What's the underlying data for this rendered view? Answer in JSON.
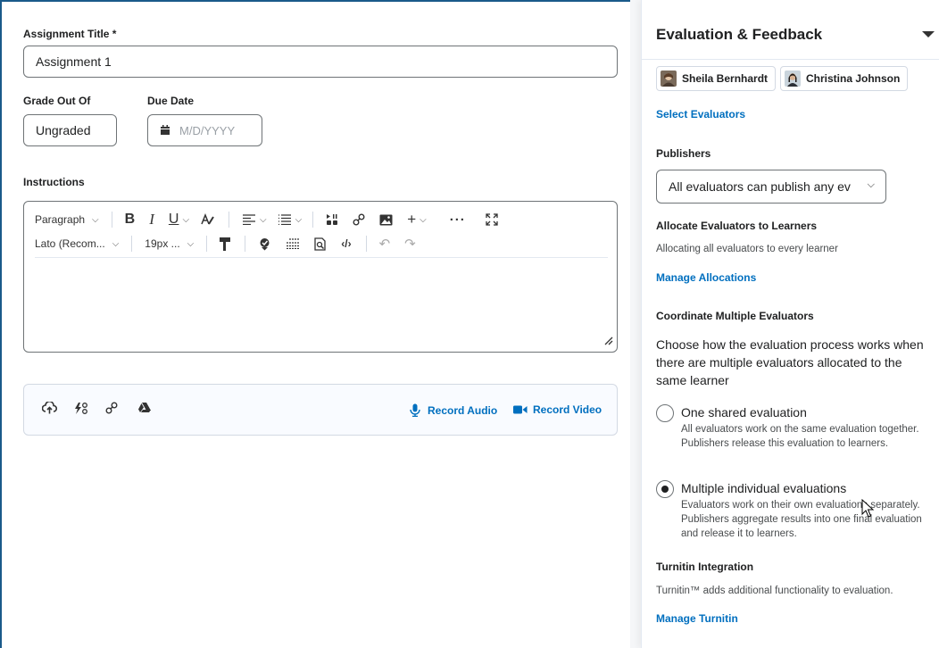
{
  "left": {
    "assignment_title_label": "Assignment Title *",
    "assignment_title_value": "Assignment 1",
    "grade_label": "Grade Out Of",
    "grade_value": "Ungraded",
    "due_label": "Due Date",
    "due_placeholder": "M/D/YYYY",
    "instructions_label": "Instructions",
    "toolbar": {
      "paragraph": "Paragraph",
      "font": "Lato (Recom...",
      "size": "19px ...",
      "bold": "B",
      "italic": "I",
      "underline": "U",
      "plus": "+",
      "more": "···"
    },
    "attach": {
      "record_audio": "Record Audio",
      "record_video": "Record Video"
    }
  },
  "right": {
    "title": "Evaluation & Feedback",
    "evaluators": [
      "Sheila Bernhardt",
      "Christina Johnson"
    ],
    "select_evaluators": "Select Evaluators",
    "publishers_label": "Publishers",
    "publishers_value": "All evaluators can publish any ev",
    "allocate_label": "Allocate Evaluators to Learners",
    "allocate_text": "Allocating all evaluators to every learner",
    "manage_allocations": "Manage Allocations",
    "coordinate_label": "Coordinate Multiple Evaluators",
    "coordinate_text": "Choose how the evaluation process works when there are multiple evaluators allocated to the same learner",
    "option1_title": "One shared evaluation",
    "option1_desc": "All evaluators work on the same evaluation together. Publishers release this evaluation to learners.",
    "option2_title": "Multiple individual evaluations",
    "option2_desc": "Evaluators work on their own evaluations separately. Publishers aggregate results into one final evaluation and release it to learners.",
    "turnitin_label": "Turnitin Integration",
    "turnitin_text": "Turnitin™ adds additional functionality to evaluation.",
    "manage_turnitin": "Manage Turnitin"
  },
  "colors": {
    "link": "#006fbf",
    "border": "#6e7376",
    "frame": "#1a5a8a"
  }
}
